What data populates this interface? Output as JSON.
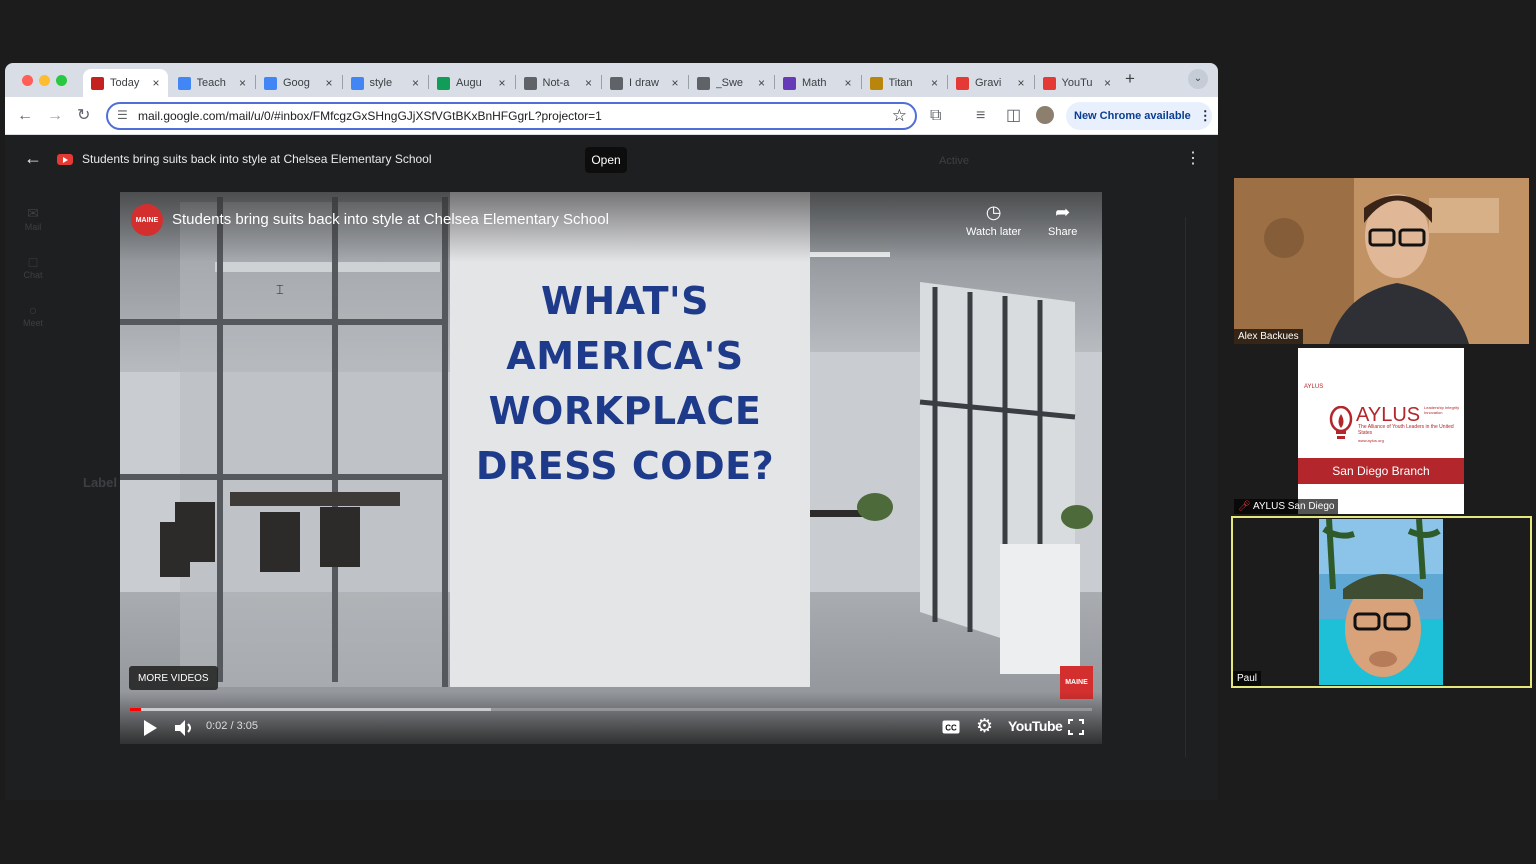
{
  "browser": {
    "tabs": [
      {
        "title": "Today",
        "icon": "gmail-icon",
        "color": "#c5221f",
        "active": true
      },
      {
        "title": "Teach",
        "icon": "docs-icon",
        "color": "#4285f4"
      },
      {
        "title": "Goog",
        "icon": "translate-icon",
        "color": "#4285f4"
      },
      {
        "title": "style",
        "icon": "google-icon",
        "color": "#4285f4"
      },
      {
        "title": "Augu",
        "icon": "sheets-icon",
        "color": "#0f9d58"
      },
      {
        "title": "Not-a",
        "icon": "globe-icon",
        "color": "#5f6368"
      },
      {
        "title": "I draw",
        "icon": "bird-icon",
        "color": "#5f6368"
      },
      {
        "title": "_Swe",
        "icon": "globe-icon",
        "color": "#5f6368"
      },
      {
        "title": "Math",
        "icon": "forms-icon",
        "color": "#673ab7"
      },
      {
        "title": "Titan",
        "icon": "torch-icon",
        "color": "#b8860b"
      },
      {
        "title": "Gravi",
        "icon": "youtube-icon",
        "color": "#e53935"
      },
      {
        "title": "YouTu",
        "icon": "youtube-icon",
        "color": "#e53935"
      }
    ],
    "url": "mail.google.com/mail/u/0/#inbox/FMfcgzGxSHngGJjXSfVGtBKxBnHFGgrL?projector=1",
    "new_chrome": "New Chrome available"
  },
  "viewer": {
    "title": "Students bring suits back into style at Chelsea Elementary School",
    "open_label": "Open",
    "gmail_status": "Active"
  },
  "gmail_bg": {
    "rail": [
      "Mail",
      "Chat",
      "Meet"
    ],
    "labels_heading": "Label"
  },
  "video": {
    "channel_logo_text": "MAINE",
    "title": "Students bring suits back into style at Chelsea Elementary School",
    "watch_later": "Watch later",
    "share": "Share",
    "headline": [
      "WHAT'S",
      "AMERICA'S",
      "WORKPLACE",
      "DRESS CODE?"
    ],
    "more_videos": "MORE VIDEOS",
    "time": "0:02 / 3:05",
    "progress_played": 0.011,
    "progress_buffered": 0.375,
    "youtube_label": "YouTube"
  },
  "participants": [
    {
      "name": "Alex Backues"
    },
    {
      "name": "AYLUS San Diego",
      "slide": {
        "small_brand": "AYLUS",
        "brand": "AYLUS",
        "tagline": "Leadership Integrity Innovation",
        "subtitle": "The Alliance of Youth Leaders in the United States",
        "site": "www.aylus.org",
        "branch": "San Diego Branch"
      }
    },
    {
      "name": "Paul"
    }
  ],
  "colors": {
    "headline": "#1e3a8a",
    "progress": "#ff0000",
    "active_speaker_border": "#e4e87c",
    "aylus_red": "#b3262b"
  }
}
